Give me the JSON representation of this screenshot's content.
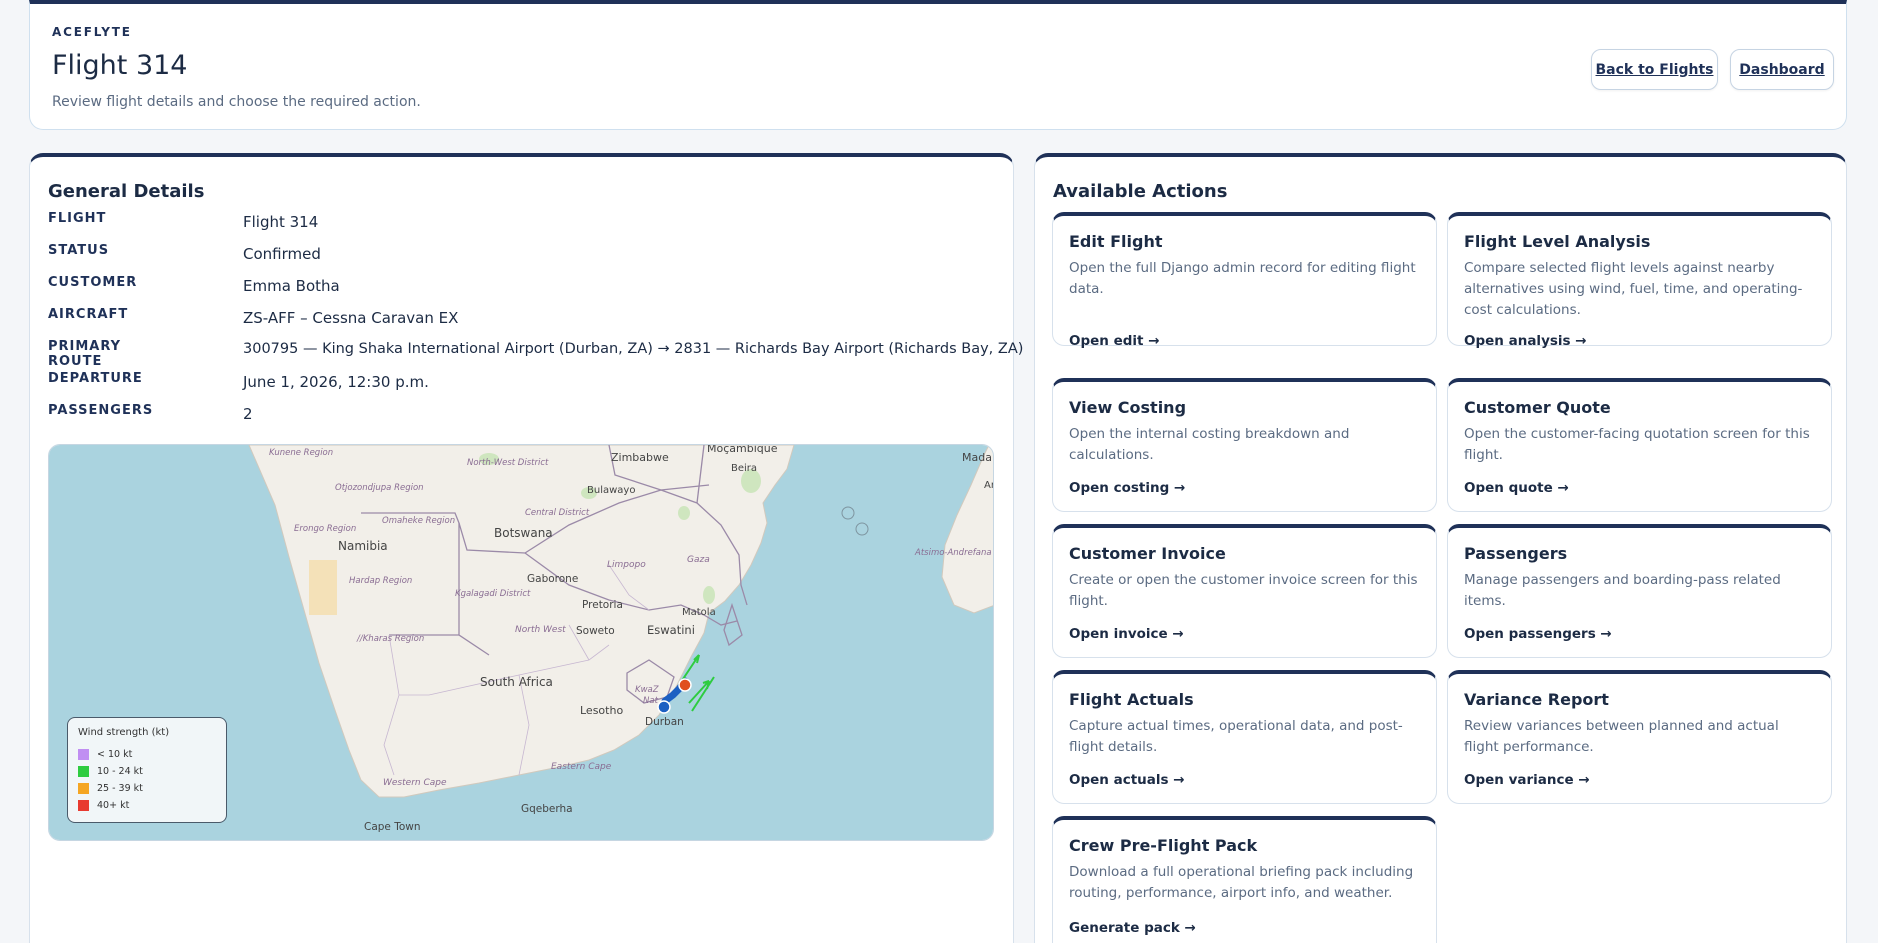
{
  "header": {
    "brand": "ACEFLYTE",
    "title": "Flight 314",
    "subtitle": "Review flight details and choose the required action.",
    "back_label": "Back to Flights",
    "dashboard_label": "Dashboard"
  },
  "general": {
    "heading": "General Details",
    "rows": [
      {
        "label": "FLIGHT",
        "value": "Flight 314"
      },
      {
        "label": "STATUS",
        "value": "Confirmed"
      },
      {
        "label": "CUSTOMER",
        "value": "Emma Botha"
      },
      {
        "label": "AIRCRAFT",
        "value": "ZS-AFF – Cessna Caravan EX"
      },
      {
        "label": "PRIMARY ROUTE",
        "value": "300795 — King Shaka International Airport (Durban, ZA) → 2831 — Richards Bay Airport (Richards Bay, ZA)"
      },
      {
        "label": "DEPARTURE",
        "value": "June 1, 2026, 12:30 p.m."
      },
      {
        "label": "PASSENGERS",
        "value": "2"
      }
    ]
  },
  "map": {
    "places": {
      "zimbabwe": "Zimbabwe",
      "mocambique": "Moçambique",
      "beira": "Beira",
      "bulawayo": "Bulawayo",
      "botswana": "Botswana",
      "namibia": "Namibia",
      "gaborone": "Gaborone",
      "pretoria": "Pretoria",
      "soweto": "Soweto",
      "eswatini": "Eswatini",
      "matola": "Matola",
      "limpopo": "Limpopo",
      "gaza": "Gaza",
      "north_west": "North West",
      "south_africa": "South Africa",
      "lesotho": "Lesotho",
      "durban": "Durban",
      "kwazulu": "KwaZ",
      "natal": "Nat",
      "cape_town": "Cape Town",
      "gqeberha": "Gqeberha",
      "western_cape": "Western Cape",
      "eastern_cape": "Eastern Cape",
      "kunene": "Kunene Region",
      "otjozondjupa": "Otjozondjupa Region",
      "omaheke": "Omaheke Region",
      "erongo": "Erongo Region",
      "hardap": "Hardap Region",
      "karas": "//Kharas Region",
      "kgalagadi": "Kgalagadi District",
      "north_west_district": "North-West District",
      "central_district": "Central District",
      "atsimo": "Atsimo-Andrefana",
      "mada": "Mada",
      "ar": "Ar"
    },
    "legend": {
      "title": "Wind strength (kt)",
      "items": [
        {
          "label": "< 10 kt",
          "color": "#c08ef2"
        },
        {
          "label": "10 - 24 kt",
          "color": "#2ecc40"
        },
        {
          "label": "25 - 39 kt",
          "color": "#f5a623"
        },
        {
          "label": "40+ kt",
          "color": "#e83a30"
        }
      ]
    }
  },
  "actions": {
    "heading": "Available Actions",
    "cards": [
      {
        "title": "Edit Flight",
        "desc": "Open the full Django admin record for editing flight data.",
        "link": "Open edit →"
      },
      {
        "title": "Flight Level Analysis",
        "desc": "Compare selected flight levels against nearby alternatives using wind, fuel, time, and operating-cost calculations.",
        "link": "Open analysis →"
      },
      {
        "title": "View Costing",
        "desc": "Open the internal costing breakdown and calculations.",
        "link": "Open costing →"
      },
      {
        "title": "Customer Quote",
        "desc": "Open the customer-facing quotation screen for this flight.",
        "link": "Open quote →"
      },
      {
        "title": "Customer Invoice",
        "desc": "Create or open the customer invoice screen for this flight.",
        "link": "Open invoice →"
      },
      {
        "title": "Passengers",
        "desc": "Manage passengers and boarding-pass related items.",
        "link": "Open passengers →"
      },
      {
        "title": "Flight Actuals",
        "desc": "Capture actual times, operational data, and post-flight details.",
        "link": "Open actuals →"
      },
      {
        "title": "Variance Report",
        "desc": "Review variances between planned and actual flight performance.",
        "link": "Open variance →"
      },
      {
        "title": "Crew Pre-Flight Pack",
        "desc": "Download a full operational briefing pack including routing, performance, airport info, and weather.",
        "link": "Generate pack →"
      }
    ]
  }
}
